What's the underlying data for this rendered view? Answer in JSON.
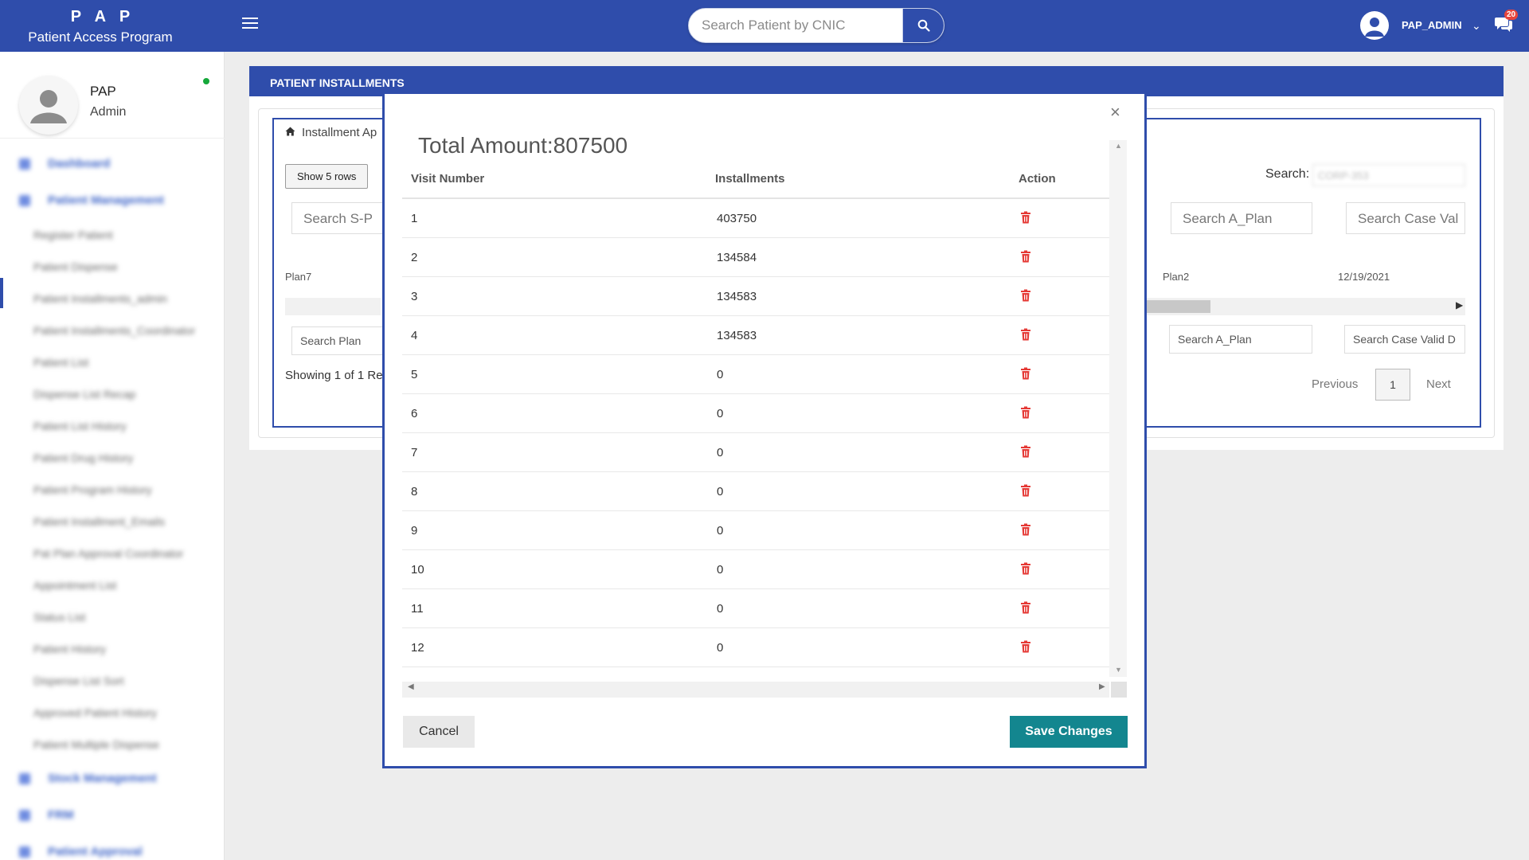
{
  "app": {
    "brand_short": "P A P",
    "brand_full": "Patient Access Program"
  },
  "header": {
    "search_placeholder": "Search Patient by CNIC",
    "user_name": "PAP_ADMIN",
    "chat_badge": "20"
  },
  "sidebar": {
    "profile_name": "PAP",
    "profile_role": "Admin",
    "menu": [
      {
        "type": "sec",
        "label": "Dashboard"
      },
      {
        "type": "sec",
        "label": "Patient Management"
      },
      {
        "type": "sub",
        "label": "Register Patient"
      },
      {
        "type": "sub",
        "label": "Patient Dispense"
      },
      {
        "type": "sub",
        "label": "Patient Installments_admin"
      },
      {
        "type": "sub",
        "label": "Patient Installments_Coordinator"
      },
      {
        "type": "sub",
        "label": "Patient List"
      },
      {
        "type": "sub",
        "label": "Dispense List Recap"
      },
      {
        "type": "sub",
        "label": "Patient List History"
      },
      {
        "type": "sub",
        "label": "Patient Drug History"
      },
      {
        "type": "sub",
        "label": "Patient Program History"
      },
      {
        "type": "sub",
        "label": "Patient Installment_Emails"
      },
      {
        "type": "sub",
        "label": "Pat Plan Approval Coordinator"
      },
      {
        "type": "sub",
        "label": "Appointment List"
      },
      {
        "type": "sub",
        "label": "Status List"
      },
      {
        "type": "sub",
        "label": "Patient History"
      },
      {
        "type": "sub",
        "label": "Dispense List Sort"
      },
      {
        "type": "sub",
        "label": "Approved Patient History"
      },
      {
        "type": "sub",
        "label": "Patient Multiple Dispense"
      },
      {
        "type": "sec",
        "label": "Stock Management"
      },
      {
        "type": "sec",
        "label": "FRM"
      },
      {
        "type": "sec",
        "label": "Patient Approval"
      }
    ]
  },
  "page": {
    "panel_title": "PATIENT INSTALLMENTS",
    "breadcrumb": "Installment Ap",
    "show_rows": "Show 5 rows",
    "search_left_top": "Search   S-P",
    "plan7": "Plan7",
    "search_left_bottom": "Search     Plan",
    "showing": "Showing 1 of 1 Re",
    "search_label": "Search:",
    "search_value": "CORP-353",
    "col_search_1": "Search    A_Plan",
    "col_search_2": "Search    Case Val",
    "plan2": "Plan2",
    "date": "12/19/2021",
    "col_search_3": "Search     A_Plan",
    "col_search_4": "Search     Case Valid D",
    "prev": "Previous",
    "page_num": "1",
    "next": "Next"
  },
  "modal": {
    "title": "Total Amount:807500",
    "close": "×",
    "columns": [
      "Visit Number",
      "Installments",
      "Action"
    ],
    "rows": [
      {
        "visit": "1",
        "installment": "403750"
      },
      {
        "visit": "2",
        "installment": "134584"
      },
      {
        "visit": "3",
        "installment": "134583"
      },
      {
        "visit": "4",
        "installment": "134583"
      },
      {
        "visit": "5",
        "installment": "0"
      },
      {
        "visit": "6",
        "installment": "0"
      },
      {
        "visit": "7",
        "installment": "0"
      },
      {
        "visit": "8",
        "installment": "0"
      },
      {
        "visit": "9",
        "installment": "0"
      },
      {
        "visit": "10",
        "installment": "0"
      },
      {
        "visit": "11",
        "installment": "0"
      },
      {
        "visit": "12",
        "installment": "0"
      }
    ],
    "cancel": "Cancel",
    "save": "Save Changes"
  },
  "icons": {
    "delete": "trash-icon",
    "search": "search-icon",
    "home": "home-icon",
    "menu": "hamburger-icon",
    "chat": "chat-icon",
    "user": "user-avatar-icon"
  },
  "colors": {
    "primary": "#2f4dab",
    "save": "#13868f",
    "delete": "#e53935"
  }
}
